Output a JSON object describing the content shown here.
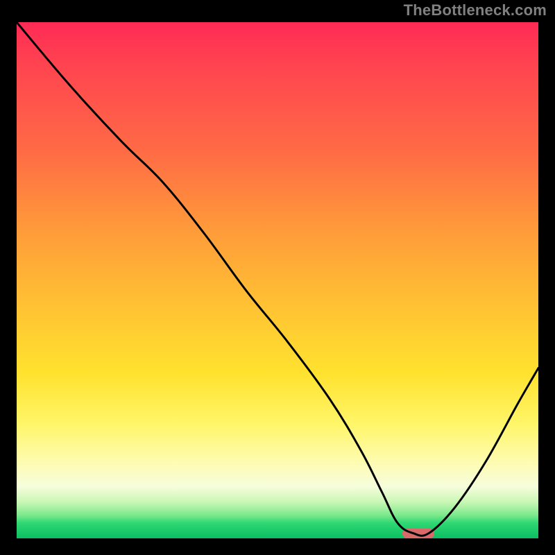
{
  "watermark": "TheBottleneck.com",
  "colors": {
    "frame_bg": "#000000",
    "watermark": "#808080",
    "curve": "#000000",
    "marker": "#d86a6a",
    "gradient": [
      "#ff2a55",
      "#ff6b45",
      "#ffc233",
      "#fff66a",
      "#0bbf63"
    ]
  },
  "chart_data": {
    "type": "line",
    "title": "",
    "xlabel": "",
    "ylabel": "",
    "xlim": [
      0,
      100
    ],
    "ylim": [
      0,
      100
    ],
    "grid": false,
    "legend_position": "none",
    "series": [
      {
        "name": "bottleneck-curve",
        "x": [
          0,
          10,
          20,
          28,
          36,
          44,
          52,
          60,
          66,
          70,
          73,
          76,
          79,
          84,
          90,
          96,
          100
        ],
        "values": [
          100,
          88,
          77,
          69,
          59,
          48,
          38,
          27,
          17,
          9,
          3,
          1,
          1,
          6,
          15,
          26,
          33
        ]
      }
    ],
    "annotations": [
      {
        "name": "optimal-marker",
        "x": 77,
        "y": 1,
        "label": ""
      }
    ],
    "note": "x/y are percentages of the plot area (0=left/bottom, 100=right/top); values are visually estimated from the figure."
  }
}
